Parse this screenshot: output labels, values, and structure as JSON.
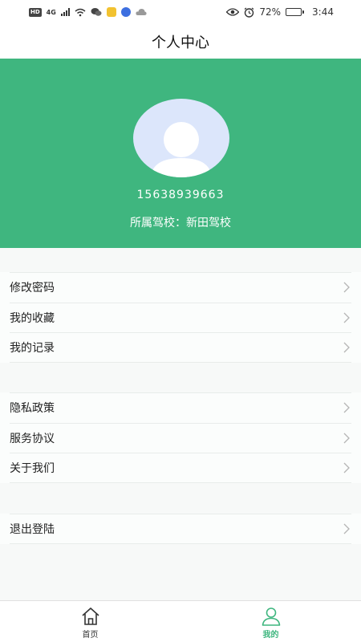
{
  "status_bar": {
    "hd_badge": "HD",
    "network": "4G",
    "battery_percent": "72%",
    "time": "3:44",
    "battery_level": 0.72
  },
  "header": {
    "title": "个人中心"
  },
  "profile": {
    "phone": "15638939663",
    "school": "所属驾校：新田驾校"
  },
  "menu_groups": [
    {
      "items": [
        {
          "label": "修改密码"
        },
        {
          "label": "我的收藏"
        },
        {
          "label": "我的记录"
        }
      ]
    },
    {
      "items": [
        {
          "label": "隐私政策"
        },
        {
          "label": "服务协议"
        },
        {
          "label": "关于我们"
        }
      ]
    },
    {
      "items": [
        {
          "label": "退出登陆"
        }
      ]
    }
  ],
  "tab_bar": {
    "tabs": [
      {
        "label": "首页",
        "icon": "home-icon",
        "active": false
      },
      {
        "label": "我的",
        "icon": "person-icon",
        "active": true
      }
    ]
  },
  "colors": {
    "accent": "#3fb67f",
    "avatar_bg": "#dce6fb",
    "divider": "#e8ecea"
  }
}
